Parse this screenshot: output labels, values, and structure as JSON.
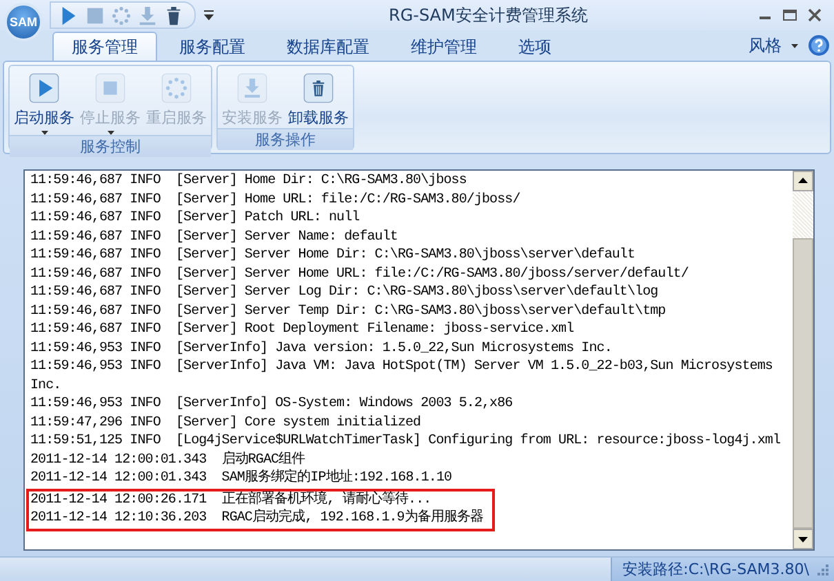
{
  "window": {
    "title": "RG-SAM安全计费管理系统"
  },
  "app_logo": "SAM",
  "tabs": [
    {
      "label": "服务管理",
      "selected": true
    },
    {
      "label": "服务配置",
      "selected": false
    },
    {
      "label": "数据库配置",
      "selected": false
    },
    {
      "label": "维护管理",
      "selected": false
    },
    {
      "label": "选项",
      "selected": false
    }
  ],
  "style_menu": {
    "label": "风格"
  },
  "ribbon_groups": [
    {
      "title": "服务控制",
      "buttons": [
        {
          "label": "启动服务",
          "kind": "play",
          "disabled": false,
          "dropdown": true
        },
        {
          "label": "停止服务",
          "kind": "stop",
          "disabled": true,
          "dropdown": true
        },
        {
          "label": "重启服务",
          "kind": "restart",
          "disabled": true,
          "dropdown": false
        }
      ]
    },
    {
      "title": "服务操作",
      "buttons": [
        {
          "label": "安装服务",
          "kind": "install",
          "disabled": true,
          "dropdown": false
        },
        {
          "label": "卸载服务",
          "kind": "uninstall",
          "disabled": false,
          "dropdown": false
        }
      ]
    }
  ],
  "log": {
    "lines": [
      {
        "text": "11:59:46,687 INFO  [Server] Home Dir: C:\\RG-SAM3.80\\jboss",
        "highlighted": false
      },
      {
        "text": "11:59:46,687 INFO  [Server] Home URL: file:/C:/RG-SAM3.80/jboss/",
        "highlighted": false
      },
      {
        "text": "11:59:46,687 INFO  [Server] Patch URL: null",
        "highlighted": false
      },
      {
        "text": "11:59:46,687 INFO  [Server] Server Name: default",
        "highlighted": false
      },
      {
        "text": "11:59:46,687 INFO  [Server] Server Home Dir: C:\\RG-SAM3.80\\jboss\\server\\default",
        "highlighted": false
      },
      {
        "text": "11:59:46,687 INFO  [Server] Server Home URL: file:/C:/RG-SAM3.80/jboss/server/default/",
        "highlighted": false
      },
      {
        "text": "11:59:46,687 INFO  [Server] Server Log Dir: C:\\RG-SAM3.80\\jboss\\server\\default\\log",
        "highlighted": false
      },
      {
        "text": "11:59:46,687 INFO  [Server] Server Temp Dir: C:\\RG-SAM3.80\\jboss\\server\\default\\tmp",
        "highlighted": false
      },
      {
        "text": "11:59:46,687 INFO  [Server] Root Deployment Filename: jboss-service.xml",
        "highlighted": false
      },
      {
        "text": "11:59:46,953 INFO  [ServerInfo] Java version: 1.5.0_22,Sun Microsystems Inc.",
        "highlighted": false
      },
      {
        "text": "11:59:46,953 INFO  [ServerInfo] Java VM: Java HotSpot(TM) Server VM 1.5.0_22-b03,Sun Microsystems",
        "highlighted": false
      },
      {
        "text": "Inc.",
        "highlighted": false
      },
      {
        "text": "11:59:46,953 INFO  [ServerInfo] OS-System: Windows 2003 5.2,x86",
        "highlighted": false
      },
      {
        "text": "11:59:47,296 INFO  [Server] Core system initialized",
        "highlighted": false
      },
      {
        "text": "11:59:51,125 INFO  [Log4jService$URLWatchTimerTask] Configuring from URL: resource:jboss-log4j.xml",
        "highlighted": false
      },
      {
        "text": "2011-12-14 12:00:01.343  启动RGAC组件",
        "highlighted": false
      },
      {
        "text": "2011-12-14 12:00:01.343  SAM服务绑定的IP地址:192.168.1.10",
        "highlighted": false
      },
      {
        "text": "2011-12-14 12:00:26.171  正在部署备机环境, 请耐心等待...",
        "highlighted": true
      },
      {
        "text": "2011-12-14 12:10:36.203  RGAC启动完成, 192.168.1.9为备用服务器",
        "highlighted": true
      }
    ]
  },
  "status_bar": {
    "text": "安装路径:C:\\RG-SAM3.80\\"
  }
}
